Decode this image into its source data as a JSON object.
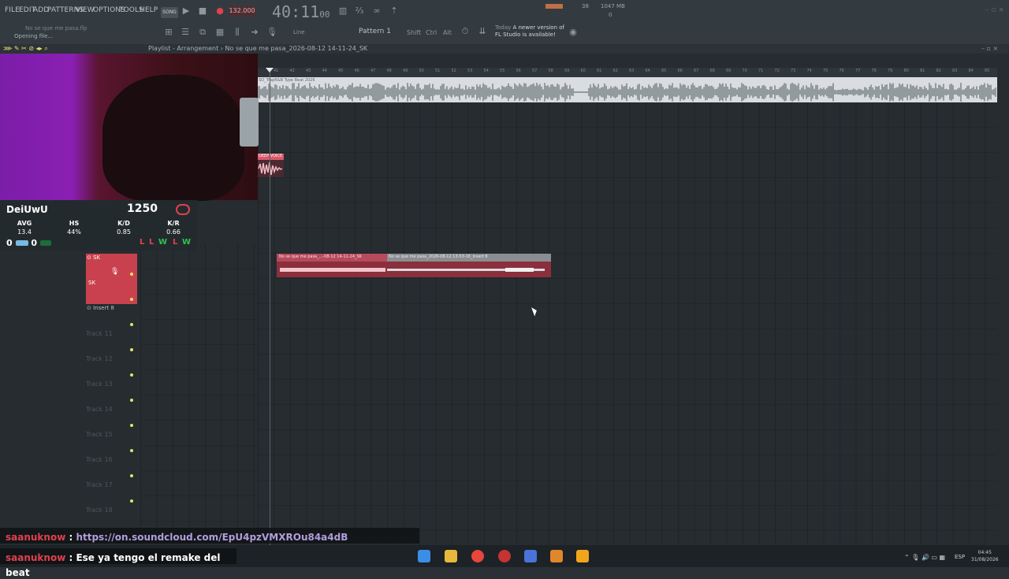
{
  "menu": {
    "file": "FILE",
    "edit": "EDIT",
    "add": "ADD",
    "patterns": "PATTERNS",
    "view": "VIEW",
    "options": "OPTIONS",
    "tools": "TOOLS",
    "help": "HELP"
  },
  "transport": {
    "song_badge": "SONG",
    "tempo": "132.000",
    "time_main": "40:11",
    "time_sub": "00"
  },
  "cpu": {
    "value": "38",
    "memory": "1047 MB",
    "voices": "0"
  },
  "hints": {
    "project": "No se que me pasa.flp",
    "status": "Opening file..."
  },
  "toolbar2": {
    "line": "Line",
    "pattern": "Pattern 1",
    "shift": "Shift",
    "ctrl": "Ctrl",
    "alt": "Alt"
  },
  "news": {
    "line1_prefix": "Today",
    "line1_text": "A newer version of",
    "line2_text": "FL Studio is available!"
  },
  "playlist": {
    "title": "Playlist - Arrangement",
    "breadcrumb": "No se que me pasa_2026-08-12 14-11-24_SK",
    "ticks": [
      "41",
      "42",
      "43",
      "44",
      "45",
      "46",
      "47",
      "48",
      "49",
      "50",
      "51",
      "52",
      "53",
      "54",
      "55",
      "56",
      "57",
      "58",
      "59",
      "60",
      "61",
      "62",
      "63",
      "64",
      "65",
      "66",
      "67",
      "68",
      "69",
      "70",
      "71",
      "72",
      "73",
      "74",
      "75",
      "76",
      "77",
      "78",
      "79",
      "80",
      "81",
      "82",
      "83",
      "84",
      "85"
    ],
    "beat_clip": "SO_TrapR&B Type Beat 2026",
    "voice_clip": "DEEP VOICE",
    "rec_clip1": "No se que me pasa_...-08-12 14-11-24_SK",
    "rec_clip2": "No se que me pasa_2026-08-12 13-53-16_Insert 8"
  },
  "tracks": {
    "sk_name": "SK",
    "sk_sub": "SK",
    "insert": "Insert 8",
    "names": [
      "Track 11",
      "Track 12",
      "Track 13",
      "Track 14",
      "Track 15",
      "Track 16",
      "Track 17",
      "Track 18"
    ]
  },
  "stats": {
    "player": "DeiUwU",
    "elo": "1250",
    "h_avg": "AVG",
    "v_avg": "13.4",
    "h_hs": "HS",
    "v_hs": "44%",
    "h_kd": "K/D",
    "v_kd": "0.85",
    "h_kr": "K/R",
    "v_kr": "0.66",
    "score_left": "0",
    "score_right": "0",
    "results": [
      "L",
      "L",
      "W",
      "L",
      "W"
    ]
  },
  "chat": [
    {
      "user": "saanuknow",
      "sep": " : ",
      "text": "https://on.soundcloud.com/EpU4pzVMXROu84a4dB"
    },
    {
      "user": "saanuknow",
      "sep": " : ",
      "text": "Ese ya tengo el remake del beat"
    }
  ],
  "tray": {
    "lang": "ESP",
    "time": "04:45",
    "date": "31/08/2026"
  },
  "colors": {
    "accent": "#e0414d",
    "clip_red": "#c9414f",
    "background": "#262c30"
  }
}
